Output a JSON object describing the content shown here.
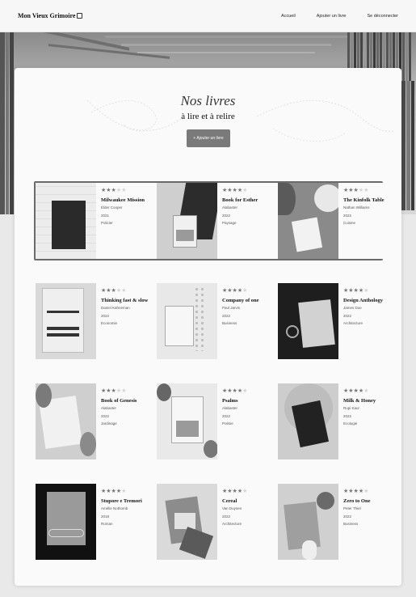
{
  "header": {
    "logo": "Mon Vieux Grimoire",
    "nav": [
      "Accueil",
      "Ajouter un livre",
      "Se déconnecter"
    ]
  },
  "main": {
    "title": "Nos livres",
    "subtitle": "à lire et à relire",
    "add_button": "+ Ajouter un livre"
  },
  "books": [
    {
      "title": "Milwaukee Mission",
      "author": "Elder Cooper",
      "year": "2021",
      "genre": "Policier",
      "rating": 3
    },
    {
      "title": "Book for Esther",
      "author": "Alabaster",
      "year": "2022",
      "genre": "Paysage",
      "rating": 4
    },
    {
      "title": "The Kinfolk Table",
      "author": "Nathan Williams",
      "year": "2022",
      "genre": "Cuisine",
      "rating": 3
    },
    {
      "title": "Thinking fast & slow",
      "author": "Daniel Kahneman",
      "year": "2022",
      "genre": "Economie",
      "rating": 3
    },
    {
      "title": "Company of one",
      "author": "Paul Jarvis",
      "year": "2022",
      "genre": "Business",
      "rating": 4
    },
    {
      "title": "Design Anthology",
      "author": "James Doe",
      "year": "2022",
      "genre": "Architecture",
      "rating": 4
    },
    {
      "title": "Book of Genesis",
      "author": "Alabaster",
      "year": "2022",
      "genre": "Jardinage",
      "rating": 3
    },
    {
      "title": "Psalms",
      "author": "Alabaster",
      "year": "2022",
      "genre": "Poésie",
      "rating": 4
    },
    {
      "title": "Milk & Honey",
      "author": "Rupi Kaur",
      "year": "2022",
      "genre": "Ecologie",
      "rating": 4
    },
    {
      "title": "Stupore e Tremori",
      "author": "Amélie Nothomb",
      "year": "2018",
      "genre": "Roman",
      "rating": 4
    },
    {
      "title": "Cereal",
      "author": "Van Duysen",
      "year": "2022",
      "genre": "Architecture",
      "rating": 4
    },
    {
      "title": "Zero to One",
      "author": "Peter Thiel",
      "year": "2022",
      "genre": "Business",
      "rating": 4
    }
  ]
}
